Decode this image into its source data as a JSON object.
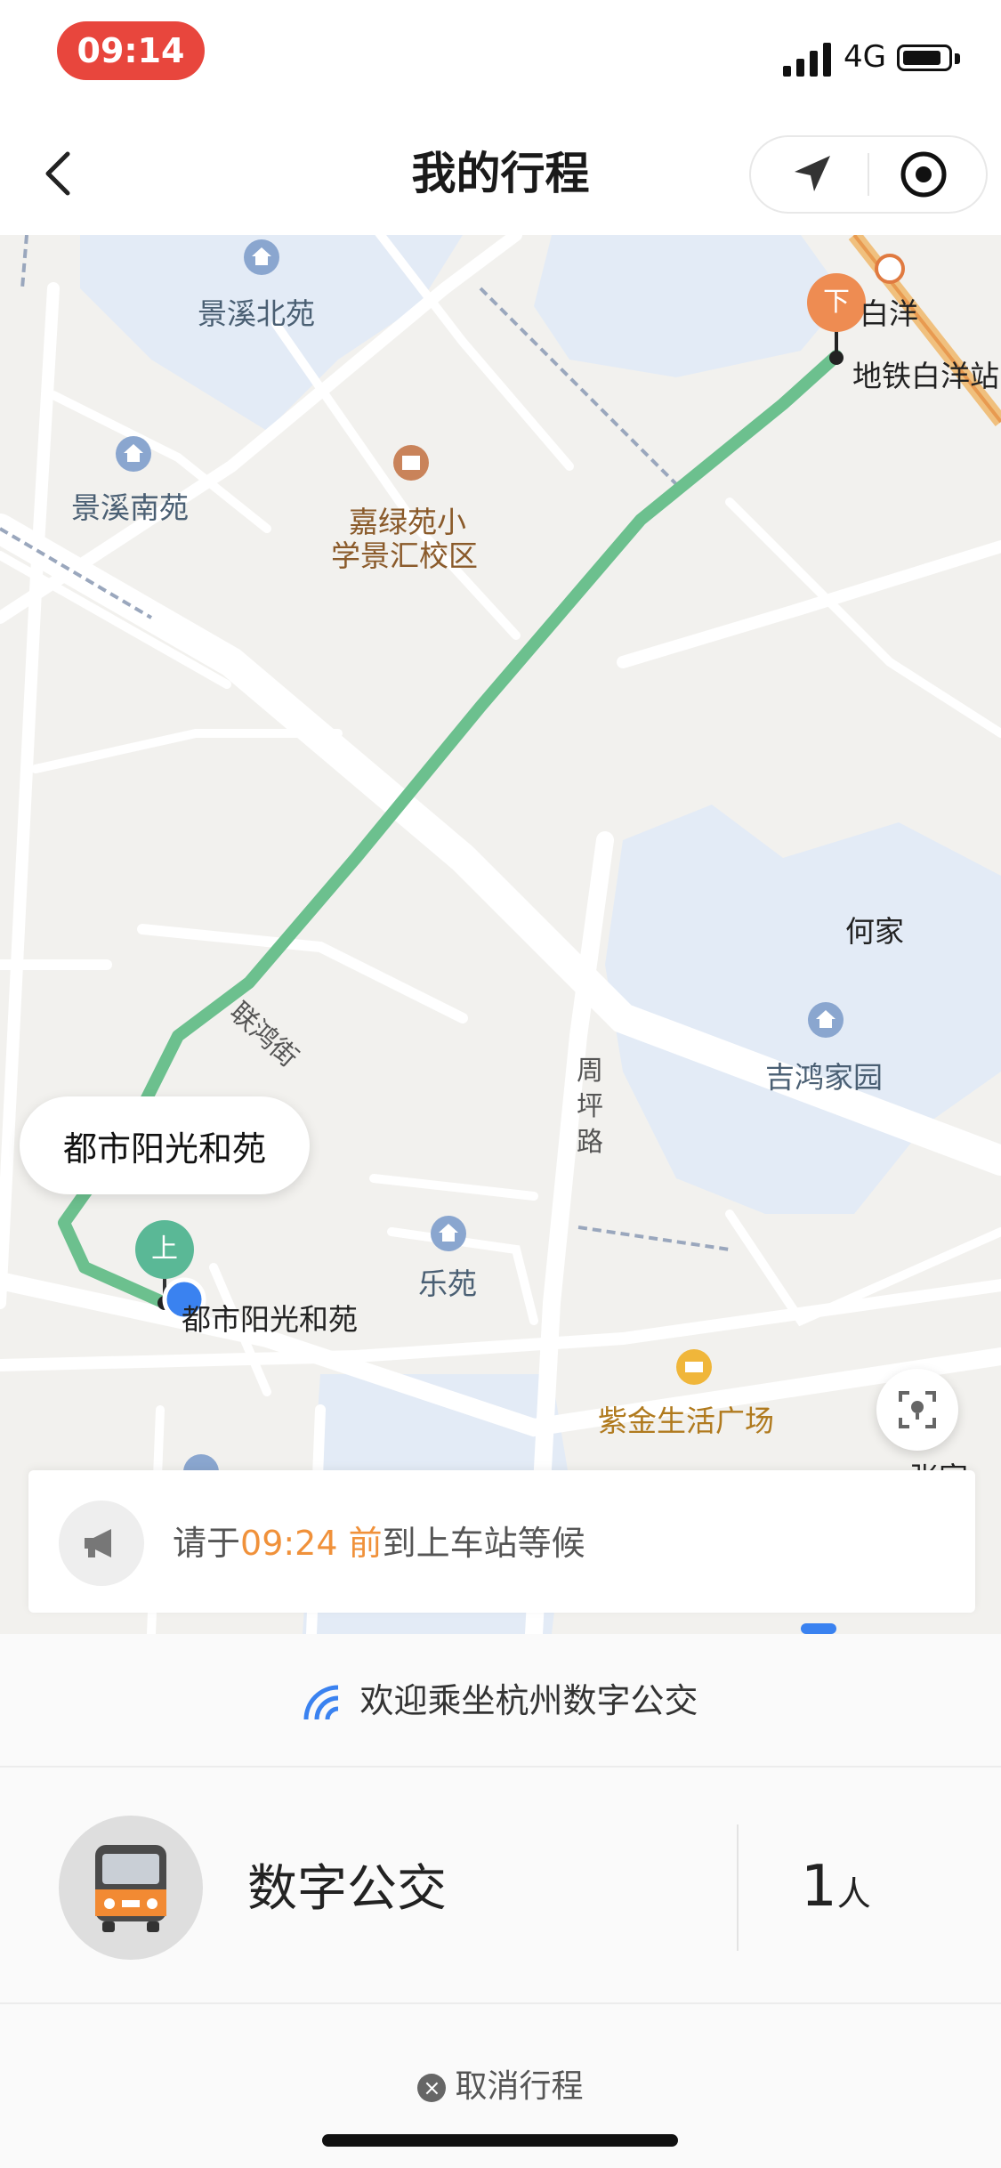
{
  "status_bar": {
    "time": "09:14",
    "network": "4G"
  },
  "header": {
    "title": "我的行程"
  },
  "map": {
    "labels": {
      "jingxi_north": "景溪北苑",
      "jingxi_south": "景溪南苑",
      "school_line1": "嘉绿苑小",
      "school_line2": "学景汇校区",
      "lianhong_street": "联鸿街",
      "baiyang": "白洋",
      "baiyang_station": "地铁白洋站",
      "hejia": "何家",
      "jihong": "吉鸿家园",
      "zhouping_road": "周坪路",
      "leyuan": "乐苑",
      "dushi_station": "都市阳光和苑",
      "zijin": "紫金生活广场",
      "zhang": "张家"
    },
    "boarding_marker": "上",
    "alighting_marker": "下",
    "callout": "都市阳光和苑"
  },
  "notice": {
    "prefix": "请于",
    "time": "09:24 前",
    "suffix": "到上车站等候"
  },
  "panel": {
    "welcome": "欢迎乘坐杭州数字公交",
    "service_name": "数字公交",
    "count": "1",
    "count_unit": "人",
    "cancel": "取消行程"
  },
  "colors": {
    "route": "#6cc08e",
    "accent": "#f0913a",
    "status_pill": "#e8463d",
    "boarding": "#5ab896",
    "alighting": "#ee8c52"
  }
}
